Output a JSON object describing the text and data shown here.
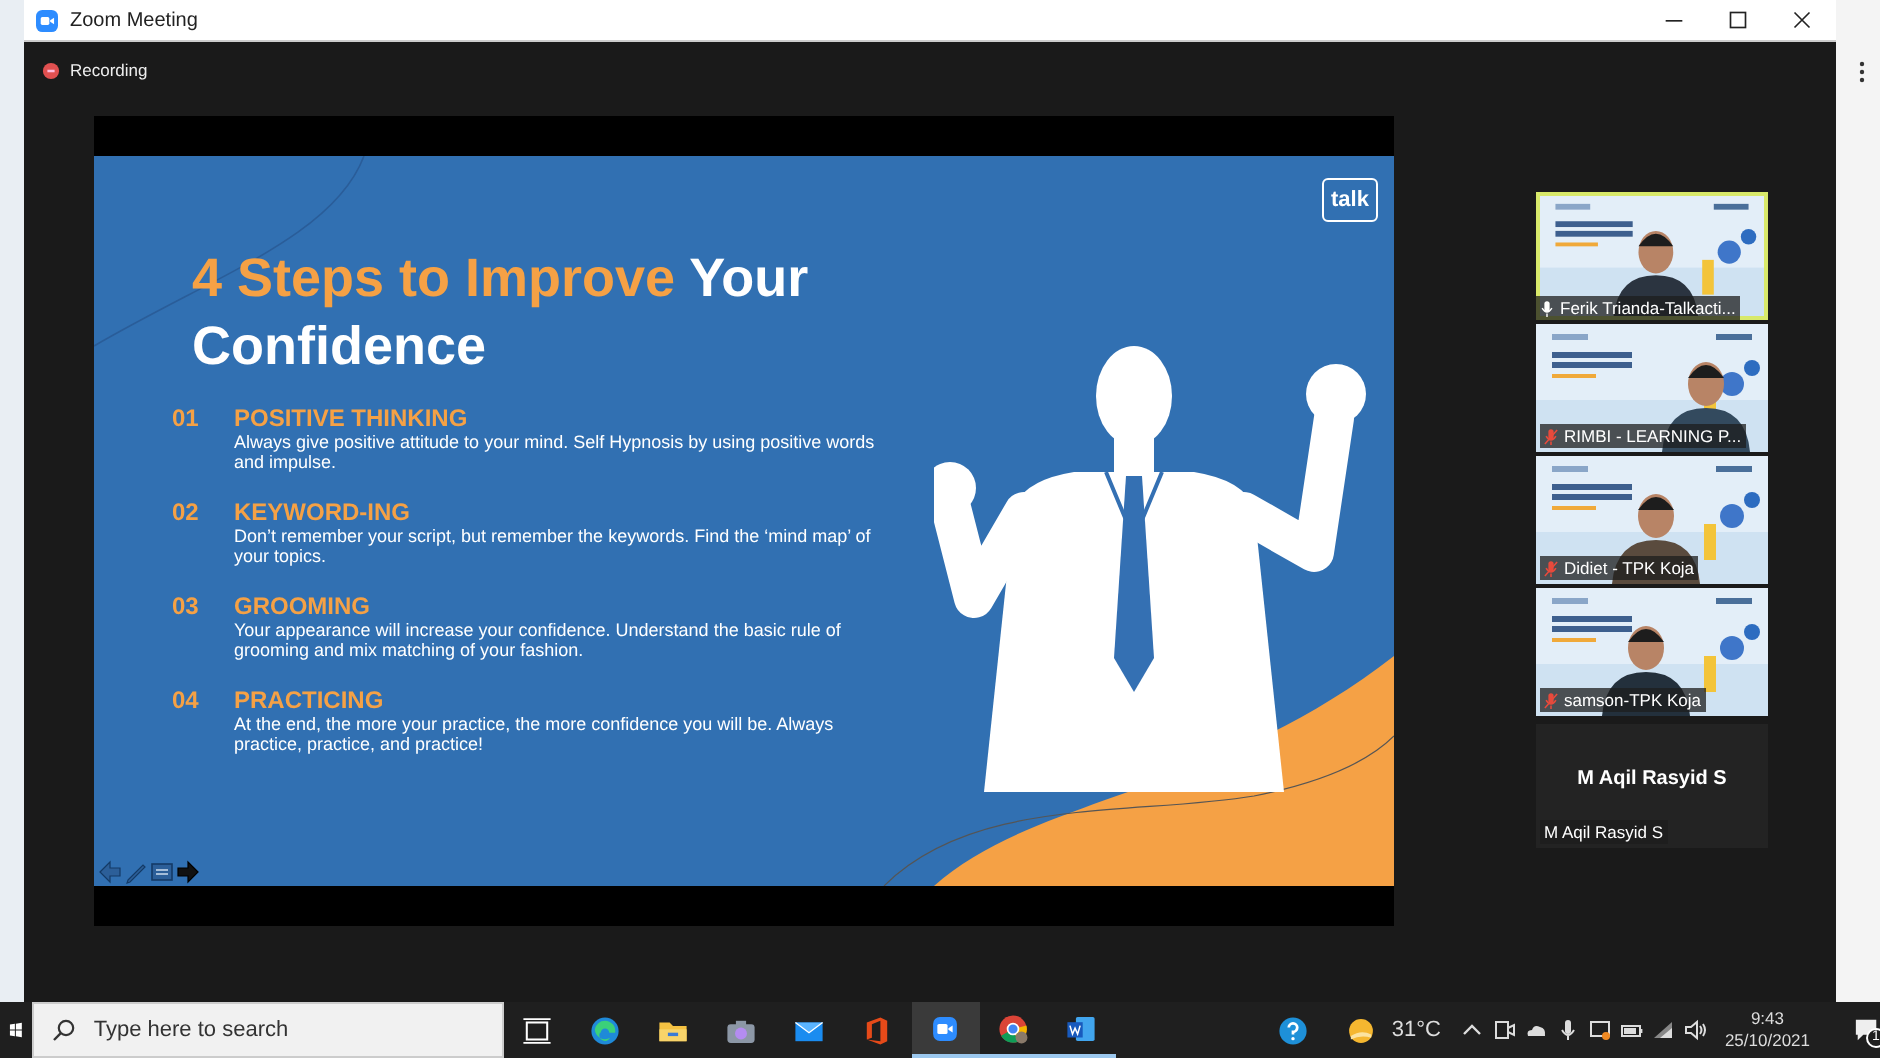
{
  "window": {
    "title": "Zoom Meeting"
  },
  "recording": {
    "label": "Recording"
  },
  "slide": {
    "logo": "talk",
    "title_highlight": "4 Steps to Improve",
    "title_rest": "Your Confidence",
    "steps": [
      {
        "number": "01",
        "heading": "POSITIVE THINKING",
        "body": "Always give positive attitude to your mind. Self Hypnosis by using positive words and  impulse."
      },
      {
        "number": "02",
        "heading": "KEYWORD-ING",
        "body": "Don’t remember your script, but remember the keywords. Find the ‘mind map’ of your topics."
      },
      {
        "number": "03",
        "heading": "GROOMING",
        "body": "Your appearance will increase your confidence. Understand the basic rule of grooming and mix matching of your fashion."
      },
      {
        "number": "04",
        "heading": "PRACTICING",
        "body": "At the end, the more your practice, the more confidence you will be. Always practice, practice, and practice!"
      }
    ]
  },
  "participants": [
    {
      "name": "Ferik Trianda-Talkacti...",
      "kind": "video",
      "speaking": true,
      "muted": false
    },
    {
      "name": "RIMBI - LEARNING P...",
      "kind": "video",
      "speaking": false,
      "muted": true
    },
    {
      "name": "Didiet - TPK Koja",
      "kind": "video",
      "speaking": false,
      "muted": true
    },
    {
      "name": "samson-TPK Koja",
      "kind": "video",
      "speaking": false,
      "muted": true
    },
    {
      "name": "M Aqil Rasyid S",
      "kind": "avatar",
      "speaking": false,
      "display_name": "M Aqil Rasyid S"
    }
  ],
  "taskbar": {
    "search": {
      "placeholder": "Type here to search"
    },
    "apps": [
      {
        "kind": "task-view",
        "running": false,
        "selected": false
      },
      {
        "kind": "edge",
        "running": false,
        "selected": false
      },
      {
        "kind": "folder",
        "running": false,
        "selected": false
      },
      {
        "kind": "camera",
        "running": false,
        "selected": false
      },
      {
        "kind": "mail",
        "running": false,
        "selected": false
      },
      {
        "kind": "office",
        "running": false,
        "selected": false
      },
      {
        "kind": "zoom",
        "running": true,
        "selected": true
      },
      {
        "kind": "chrome",
        "running": true,
        "selected": false
      },
      {
        "kind": "word",
        "running": true,
        "selected": false
      }
    ],
    "weather": {
      "temperature": "31°C"
    },
    "clock": {
      "time": "9:43",
      "date": "25/10/2021"
    },
    "notifications": {
      "count": "1"
    }
  }
}
